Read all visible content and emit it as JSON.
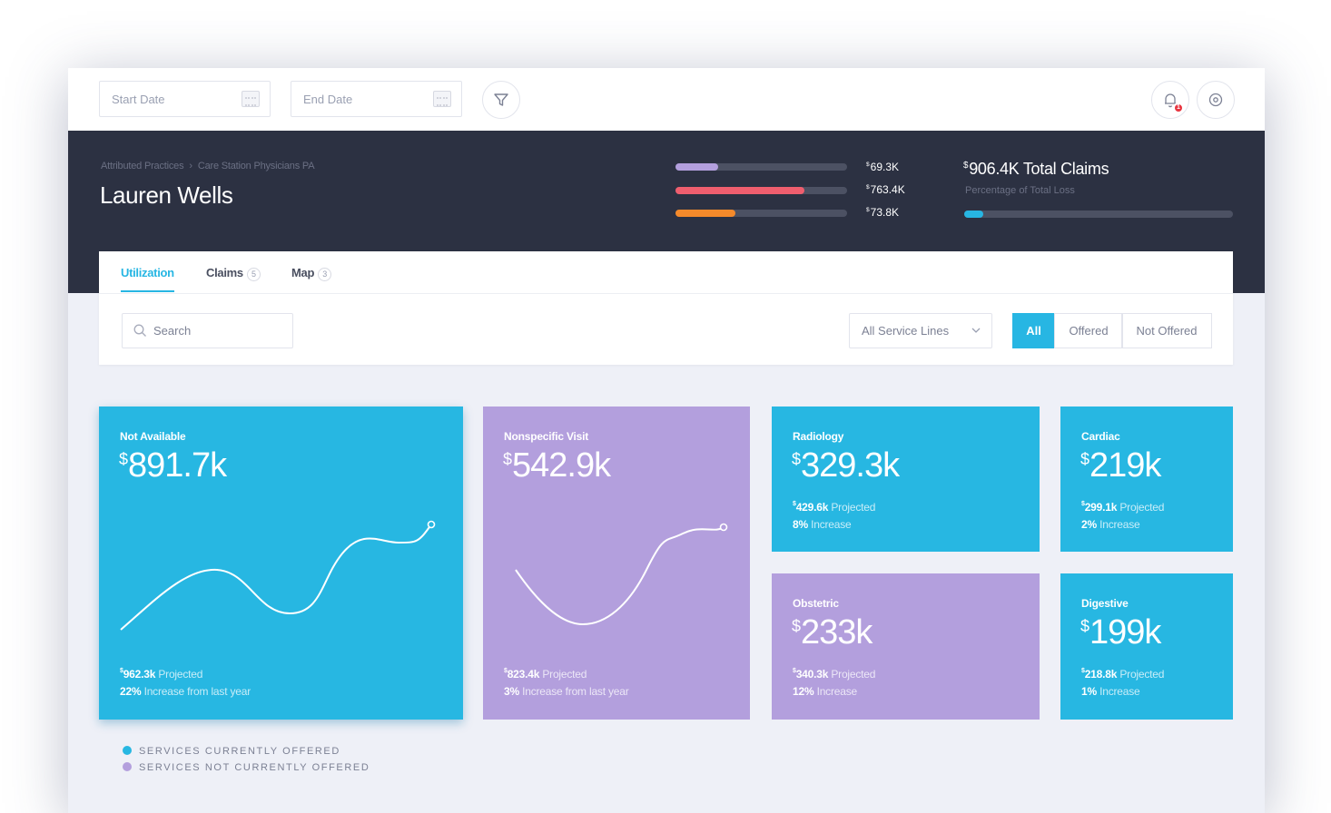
{
  "topbar": {
    "start_date_placeholder": "Start Date",
    "end_date_placeholder": "End Date",
    "notification_count": "1"
  },
  "header": {
    "breadcrumb": [
      "Attributed Practices",
      "Care Station Physicians PA"
    ],
    "person_name": "Lauren Wells",
    "bars": [
      {
        "value": "69.3K",
        "fill_fraction": 0.25,
        "color": "#b39fdd"
      },
      {
        "value": "763.4K",
        "fill_fraction": 0.75,
        "color": "#ef5e6e"
      },
      {
        "value": "73.8K",
        "fill_fraction": 0.35,
        "color": "#f58a2b"
      }
    ],
    "currency_symbol": "$",
    "total_claims_value": "906.4K",
    "total_claims_label": "Total Claims",
    "total_subtitle": "Percentage of Total Loss",
    "total_fill_fraction": 0.07
  },
  "tabs": [
    {
      "label": "Utilization",
      "badge": ""
    },
    {
      "label": "Claims",
      "badge": "5"
    },
    {
      "label": "Map",
      "badge": "3"
    }
  ],
  "filters": {
    "search_placeholder": "Search",
    "service_select": "All Service Lines",
    "segments": [
      "All",
      "Offered",
      "Not Offered"
    ]
  },
  "cards": [
    {
      "label": "Not Available",
      "amount": "891.7k",
      "projected": "962.3k",
      "projected_label": "Projected",
      "increase": "22%",
      "increase_label": "Increase from last year",
      "color": "#27b7e2"
    },
    {
      "label": "Nonspecific Visit",
      "amount": "542.9k",
      "projected": "823.4k",
      "projected_label": "Projected",
      "increase": "3%",
      "increase_label": "Increase from last year",
      "color": "#b39fdd"
    },
    {
      "label": "Radiology",
      "amount": "329.3k",
      "projected": "429.6k",
      "projected_label": "Projected",
      "increase": "8%",
      "increase_label": "Increase",
      "color": "#27b7e2"
    },
    {
      "label": "Cardiac",
      "amount": "219k",
      "projected": "299.1k",
      "projected_label": "Projected",
      "increase": "2%",
      "increase_label": "Increase",
      "color": "#27b7e2"
    },
    {
      "label": "Obstetric",
      "amount": "233k",
      "projected": "340.3k",
      "projected_label": "Projected",
      "increase": "12%",
      "increase_label": "Increase",
      "color": "#b39fdd"
    },
    {
      "label": "Digestive",
      "amount": "199k",
      "projected": "218.8k",
      "projected_label": "Projected",
      "increase": "1%",
      "increase_label": "Increase",
      "color": "#27b7e2"
    }
  ],
  "legend": [
    {
      "label": "SERVICES CURRENTLY OFFERED",
      "color": "#27b7e2"
    },
    {
      "label": "SERVICES NOT CURRENTLY OFFERED",
      "color": "#b39fdd"
    }
  ]
}
